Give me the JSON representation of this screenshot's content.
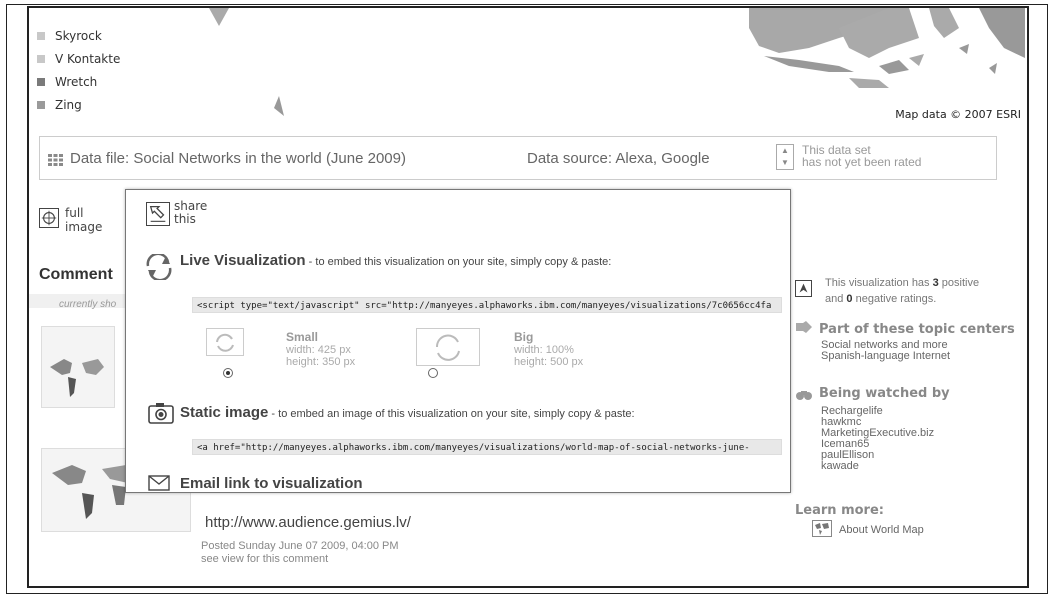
{
  "legend": {
    "items": [
      {
        "label": "Skyrock",
        "color": "#c8c8c8"
      },
      {
        "label": "V Kontakte",
        "color": "#c8c8c8"
      },
      {
        "label": "Wretch",
        "color": "#7a7a7a"
      },
      {
        "label": "Zing",
        "color": "#9a9a9a"
      }
    ]
  },
  "map": {
    "credit": "Map data © 2007 ESRI"
  },
  "databar": {
    "data_file": "Data file: Social Networks in the world (June 2009)",
    "data_source": "Data source: Alexa, Google",
    "rating_line1": "This data set",
    "rating_line2": "has not yet been rated"
  },
  "full_image": {
    "line1": "full",
    "line2": "image"
  },
  "comments": {
    "heading": "Comment",
    "shown": "currently sho",
    "url": "http://www.audience.gemius.lv/",
    "posted": "Posted Sunday June 07 2009, 04:00 PM",
    "see": "see view for this comment"
  },
  "popup": {
    "share_line1": "share",
    "share_line2": "this",
    "live_title": "Live Visualization",
    "live_sub": " - to embed this visualization on your site, simply copy & paste:",
    "live_code": "<script type=\"text/javascript\" src=\"http://manyeyes.alphaworks.ibm.com/manyeyes/visualizations/7c0656cc4fa",
    "small": {
      "label": "Small",
      "width": "width: 425 px",
      "height": "height: 350 px"
    },
    "big": {
      "label": "Big",
      "width": "width: 100%",
      "height": "height: 500 px"
    },
    "static_title": "Static image",
    "static_sub": " - to embed an image of this visualization on your site, simply copy & paste:",
    "static_code": "<a href=\"http://manyeyes.alphaworks.ibm.com/manyeyes/visualizations/world-map-of-social-networks-june-",
    "email_title": "Email link to visualization"
  },
  "sidebar": {
    "ratings_prefix": "This visualization has ",
    "positive_count": "3",
    "positive_label": " positive",
    "and": "and ",
    "negative_count": "0",
    "negative_label": " negative",
    "ratings_suffix": " ratings.",
    "topic_heading": "Part of these topic centers",
    "topics": [
      "Social networks and more",
      "Spanish-language Internet"
    ],
    "watch_heading": "Being watched by",
    "watchers": [
      "Rechargelife",
      "hawkmc",
      "MarketingExecutive.biz",
      "Iceman65",
      "paulEllison",
      "kawade"
    ],
    "learn_heading": "Learn more:",
    "about": "About World Map"
  }
}
